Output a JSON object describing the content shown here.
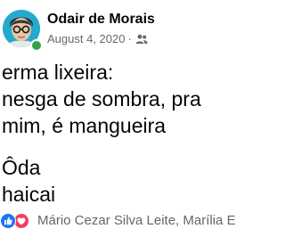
{
  "post": {
    "author": "Odair de Morais",
    "date": "August 4, 2020",
    "separator": "·",
    "audience_icon": "friends-icon",
    "text_lines": [
      "erma lixeira:",
      "nesga de sombra, pra",
      "mim, é mangueira"
    ],
    "text_lines_2": [
      "Ôda",
      "haicai"
    ]
  },
  "reactions": {
    "icons": [
      "like-icon",
      "love-icon"
    ],
    "names": "Mário Cezar Silva Leite, Marília E"
  },
  "colors": {
    "name": "#050505",
    "meta": "#65676b",
    "online": "#31a24c",
    "like": "#1877f2",
    "love": "#f33e58"
  }
}
